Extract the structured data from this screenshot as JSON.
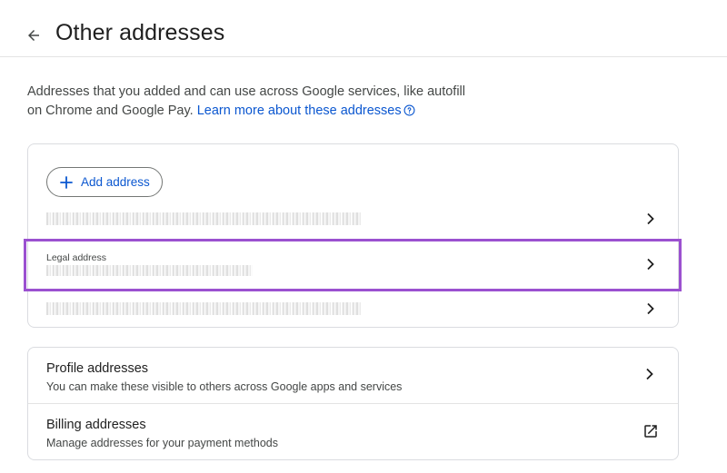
{
  "header": {
    "title": "Other addresses"
  },
  "intro": {
    "text": "Addresses that you added and can use across Google services, like autofill on Chrome and Google Pay. ",
    "link": "Learn more about these addresses"
  },
  "addresses_card": {
    "add_button_label": "Add address",
    "rows": [
      {
        "label": "",
        "value_redacted": true
      },
      {
        "label": "Legal address",
        "value_redacted": true
      },
      {
        "label": "",
        "value_redacted": true
      }
    ]
  },
  "types_card": {
    "items": [
      {
        "title": "Profile addresses",
        "subtitle": "You can make these visible to others across Google apps and services",
        "icon": "chevron-right-icon"
      },
      {
        "title": "Billing addresses",
        "subtitle": "Manage addresses for your payment methods",
        "icon": "open-in-new-icon"
      }
    ]
  },
  "colors": {
    "link": "#0b57d0",
    "highlight": "#9b51d0",
    "border": "#dadce0"
  }
}
